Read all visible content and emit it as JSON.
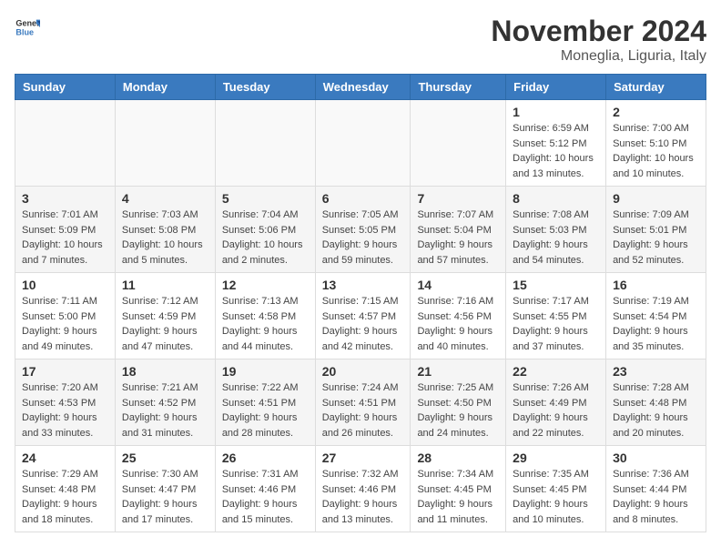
{
  "header": {
    "logo_general": "General",
    "logo_blue": "Blue",
    "month_title": "November 2024",
    "location": "Moneglia, Liguria, Italy"
  },
  "weekdays": [
    "Sunday",
    "Monday",
    "Tuesday",
    "Wednesday",
    "Thursday",
    "Friday",
    "Saturday"
  ],
  "weeks": [
    [
      {
        "day": "",
        "info": ""
      },
      {
        "day": "",
        "info": ""
      },
      {
        "day": "",
        "info": ""
      },
      {
        "day": "",
        "info": ""
      },
      {
        "day": "",
        "info": ""
      },
      {
        "day": "1",
        "info": "Sunrise: 6:59 AM\nSunset: 5:12 PM\nDaylight: 10 hours\nand 13 minutes."
      },
      {
        "day": "2",
        "info": "Sunrise: 7:00 AM\nSunset: 5:10 PM\nDaylight: 10 hours\nand 10 minutes."
      }
    ],
    [
      {
        "day": "3",
        "info": "Sunrise: 7:01 AM\nSunset: 5:09 PM\nDaylight: 10 hours\nand 7 minutes."
      },
      {
        "day": "4",
        "info": "Sunrise: 7:03 AM\nSunset: 5:08 PM\nDaylight: 10 hours\nand 5 minutes."
      },
      {
        "day": "5",
        "info": "Sunrise: 7:04 AM\nSunset: 5:06 PM\nDaylight: 10 hours\nand 2 minutes."
      },
      {
        "day": "6",
        "info": "Sunrise: 7:05 AM\nSunset: 5:05 PM\nDaylight: 9 hours\nand 59 minutes."
      },
      {
        "day": "7",
        "info": "Sunrise: 7:07 AM\nSunset: 5:04 PM\nDaylight: 9 hours\nand 57 minutes."
      },
      {
        "day": "8",
        "info": "Sunrise: 7:08 AM\nSunset: 5:03 PM\nDaylight: 9 hours\nand 54 minutes."
      },
      {
        "day": "9",
        "info": "Sunrise: 7:09 AM\nSunset: 5:01 PM\nDaylight: 9 hours\nand 52 minutes."
      }
    ],
    [
      {
        "day": "10",
        "info": "Sunrise: 7:11 AM\nSunset: 5:00 PM\nDaylight: 9 hours\nand 49 minutes."
      },
      {
        "day": "11",
        "info": "Sunrise: 7:12 AM\nSunset: 4:59 PM\nDaylight: 9 hours\nand 47 minutes."
      },
      {
        "day": "12",
        "info": "Sunrise: 7:13 AM\nSunset: 4:58 PM\nDaylight: 9 hours\nand 44 minutes."
      },
      {
        "day": "13",
        "info": "Sunrise: 7:15 AM\nSunset: 4:57 PM\nDaylight: 9 hours\nand 42 minutes."
      },
      {
        "day": "14",
        "info": "Sunrise: 7:16 AM\nSunset: 4:56 PM\nDaylight: 9 hours\nand 40 minutes."
      },
      {
        "day": "15",
        "info": "Sunrise: 7:17 AM\nSunset: 4:55 PM\nDaylight: 9 hours\nand 37 minutes."
      },
      {
        "day": "16",
        "info": "Sunrise: 7:19 AM\nSunset: 4:54 PM\nDaylight: 9 hours\nand 35 minutes."
      }
    ],
    [
      {
        "day": "17",
        "info": "Sunrise: 7:20 AM\nSunset: 4:53 PM\nDaylight: 9 hours\nand 33 minutes."
      },
      {
        "day": "18",
        "info": "Sunrise: 7:21 AM\nSunset: 4:52 PM\nDaylight: 9 hours\nand 31 minutes."
      },
      {
        "day": "19",
        "info": "Sunrise: 7:22 AM\nSunset: 4:51 PM\nDaylight: 9 hours\nand 28 minutes."
      },
      {
        "day": "20",
        "info": "Sunrise: 7:24 AM\nSunset: 4:51 PM\nDaylight: 9 hours\nand 26 minutes."
      },
      {
        "day": "21",
        "info": "Sunrise: 7:25 AM\nSunset: 4:50 PM\nDaylight: 9 hours\nand 24 minutes."
      },
      {
        "day": "22",
        "info": "Sunrise: 7:26 AM\nSunset: 4:49 PM\nDaylight: 9 hours\nand 22 minutes."
      },
      {
        "day": "23",
        "info": "Sunrise: 7:28 AM\nSunset: 4:48 PM\nDaylight: 9 hours\nand 20 minutes."
      }
    ],
    [
      {
        "day": "24",
        "info": "Sunrise: 7:29 AM\nSunset: 4:48 PM\nDaylight: 9 hours\nand 18 minutes."
      },
      {
        "day": "25",
        "info": "Sunrise: 7:30 AM\nSunset: 4:47 PM\nDaylight: 9 hours\nand 17 minutes."
      },
      {
        "day": "26",
        "info": "Sunrise: 7:31 AM\nSunset: 4:46 PM\nDaylight: 9 hours\nand 15 minutes."
      },
      {
        "day": "27",
        "info": "Sunrise: 7:32 AM\nSunset: 4:46 PM\nDaylight: 9 hours\nand 13 minutes."
      },
      {
        "day": "28",
        "info": "Sunrise: 7:34 AM\nSunset: 4:45 PM\nDaylight: 9 hours\nand 11 minutes."
      },
      {
        "day": "29",
        "info": "Sunrise: 7:35 AM\nSunset: 4:45 PM\nDaylight: 9 hours\nand 10 minutes."
      },
      {
        "day": "30",
        "info": "Sunrise: 7:36 AM\nSunset: 4:44 PM\nDaylight: 9 hours\nand 8 minutes."
      }
    ]
  ]
}
